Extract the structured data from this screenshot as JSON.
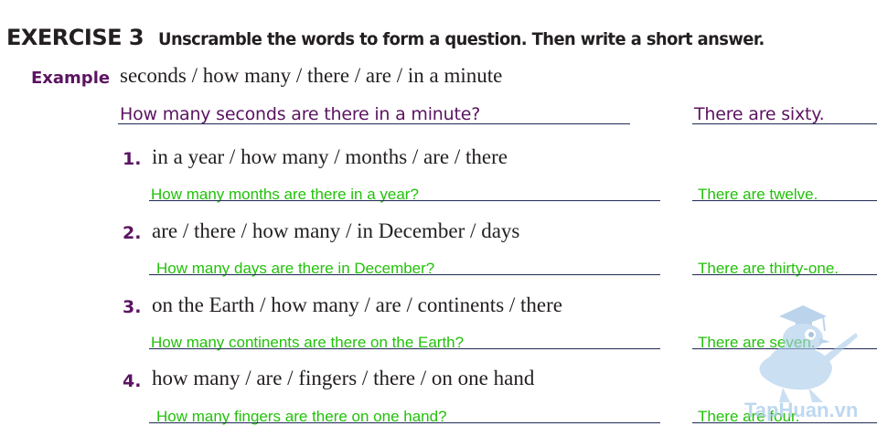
{
  "header": {
    "exercise_label": "EXERCISE 3",
    "instructions": "Unscramble the words to form a question. Then write a short answer."
  },
  "example": {
    "label": "Example",
    "prompt": "seconds / how many / there / are / in a minute",
    "question": "How many seconds are there in a minute?",
    "answer": "There are sixty."
  },
  "items": [
    {
      "number": "1.",
      "prompt": "in a year / how many / months / are / there",
      "question": "How many months are there in a year?",
      "answer": "There are twelve."
    },
    {
      "number": "2.",
      "prompt": "are / there / how many / in December / days",
      "question": "How many days are there in December?",
      "answer": "There are thirty-one."
    },
    {
      "number": "3.",
      "prompt": "on the Earth / how many / are / continents / there",
      "question": "How many continents are there on the Earth?",
      "answer": "There are seven."
    },
    {
      "number": "4.",
      "prompt": "how many / are / fingers / there / on one hand",
      "question": "How many fingers are there on one hand?",
      "answer": "There are four."
    }
  ],
  "watermark": {
    "text": "TapHuan.vn",
    "icon": "owl-mascot-icon"
  },
  "colors": {
    "heading": "#231f20",
    "example_purple": "#5b1461",
    "answer_green": "#22c10a",
    "rule_navy": "#1f2a55",
    "watermark_blue": "#a9cbea"
  }
}
